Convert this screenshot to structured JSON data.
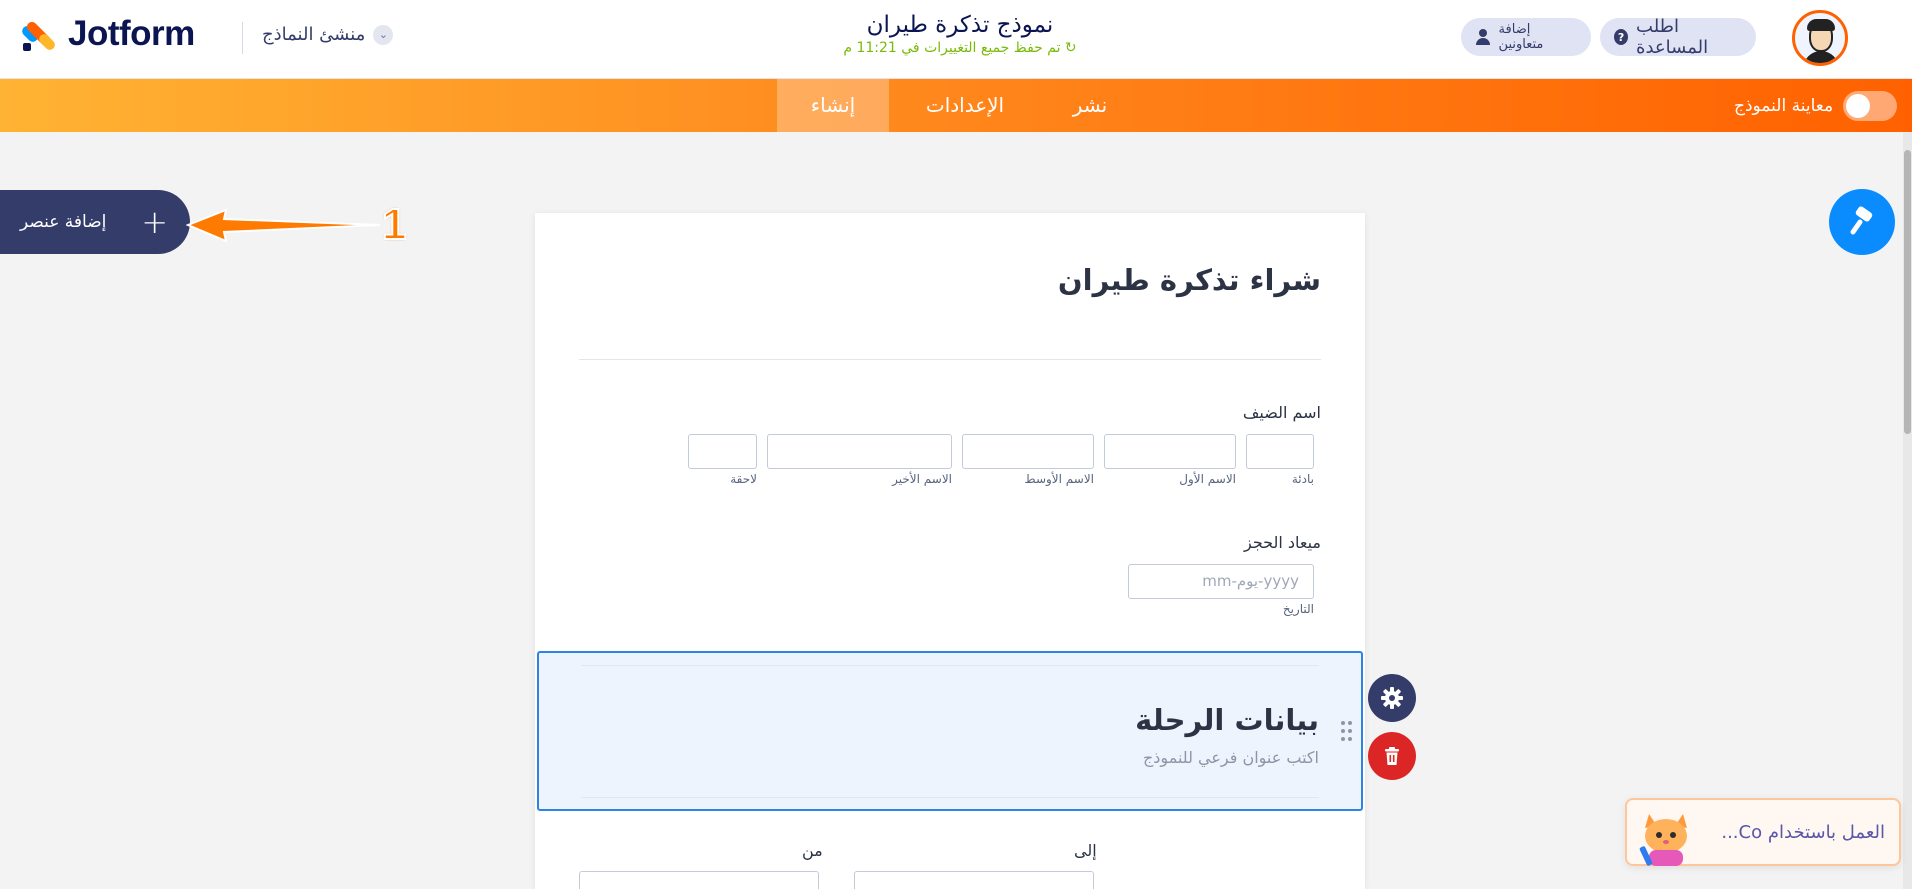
{
  "header": {
    "logo_text": "Jotform",
    "builder_menu": "منشئ النماذج",
    "form_title": "نموذج تذكرة طيران",
    "save_status": "تم حفظ جميع التغييرات في 11:21 م",
    "help_button": "اطلب المساعدة",
    "collaborators_button": "إضافة متعاونين"
  },
  "nav": {
    "tab_build": "إنشاء",
    "tab_settings": "الإعدادات",
    "tab_publish": "نشر",
    "preview_label": "معاينة النموذج",
    "preview_enabled": false
  },
  "left_panel": {
    "add_element_label": "إضافة عنصر",
    "annotation_number": "1"
  },
  "form": {
    "heading": "شراء تذكرة طيران",
    "guest_name": {
      "label": "اسم الضيف",
      "sublabels": {
        "prefix": "بادئة",
        "first": "الاسم الأول",
        "middle": "الاسم الأوسط",
        "last": "الاسم الأخير",
        "suffix": "لاحقة"
      }
    },
    "booking_date": {
      "label": "ميعاد الحجز",
      "placeholder": "yyyy-يوم-mm",
      "sublabel": "التاريخ"
    },
    "section": {
      "title": "بيانات الرحلة",
      "subtitle_placeholder": "اكتب عنوان فرعي للنموذج"
    },
    "to_label": "إلى",
    "from_label": "من"
  },
  "assistant": {
    "text": "العمل باستخدام Co..."
  },
  "colors": {
    "nav_gradient_start": "#ffb333",
    "nav_gradient_end": "#ff6100",
    "selection_border": "#2e84e6",
    "designer_button": "#0a8cff",
    "delete_button": "#dc2626",
    "save_status": "#78bb07"
  }
}
